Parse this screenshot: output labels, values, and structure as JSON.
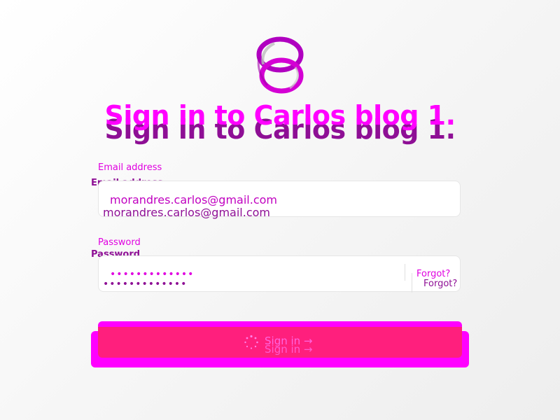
{
  "header": {
    "title": "Sign in to Carlos blog 1."
  },
  "form": {
    "email": {
      "label": "Email address",
      "value": "morandres.carlos@gmail.com"
    },
    "password": {
      "label": "Password",
      "value": "•••••••••••••",
      "forgot_label": "Forgot?"
    },
    "submit": {
      "label": "Sign in →"
    }
  },
  "colors": {
    "accent": "#ff00ff",
    "accent_dark": "#8e0f95",
    "button": "#ff1f7d"
  }
}
